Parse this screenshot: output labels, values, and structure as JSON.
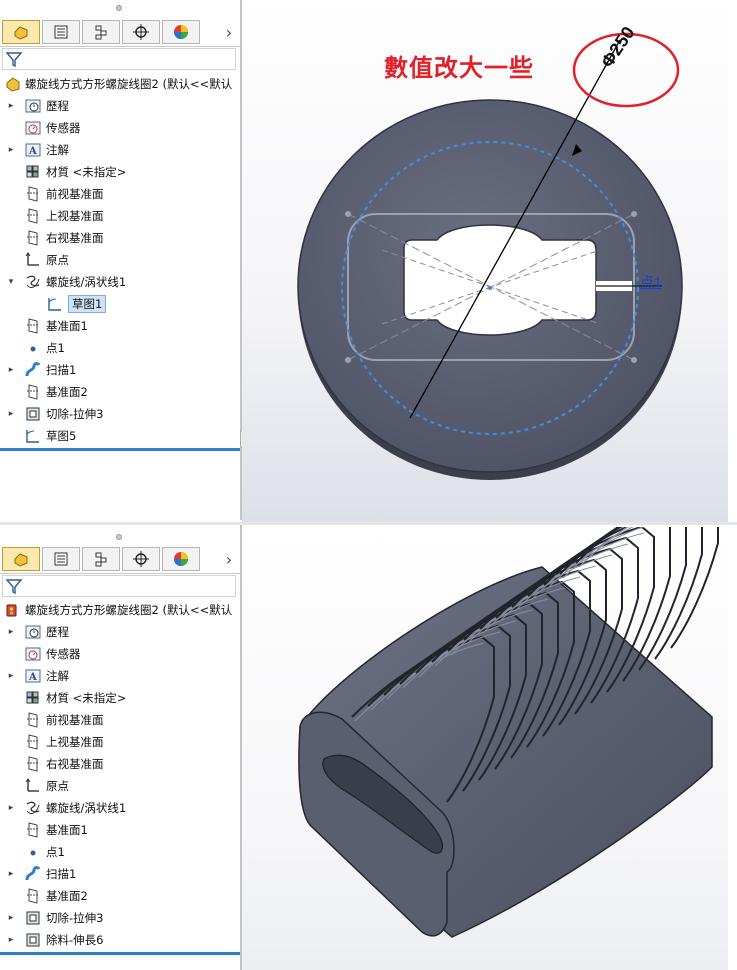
{
  "annotation": {
    "title": "數值改大一些",
    "dimension_text": "Φ250",
    "point_label": "点1"
  },
  "panels": [
    {
      "id": "top",
      "root_label": "螺旋线方式方形螺旋线圈2 (默认<<默认",
      "items": [
        {
          "label": "歷程",
          "icon": "history-icon",
          "arrow": "collapsed"
        },
        {
          "label": "传感器",
          "icon": "sensor-icon",
          "arrow": ""
        },
        {
          "label": "注解",
          "icon": "annotation-icon",
          "arrow": "collapsed"
        },
        {
          "label": "材質 <未指定>",
          "icon": "material-icon",
          "arrow": ""
        },
        {
          "label": "前视基准面",
          "icon": "plane-icon",
          "arrow": ""
        },
        {
          "label": "上视基准面",
          "icon": "plane-icon",
          "arrow": ""
        },
        {
          "label": "右视基准面",
          "icon": "plane-icon",
          "arrow": ""
        },
        {
          "label": "原点",
          "icon": "origin-icon",
          "arrow": ""
        },
        {
          "label": "螺旋线/涡状线1",
          "icon": "helix-icon",
          "arrow": "expanded"
        },
        {
          "label": "草图1",
          "icon": "sketch-icon",
          "arrow": "",
          "child": true,
          "selected": true
        },
        {
          "label": "基准面1",
          "icon": "plane-icon",
          "arrow": ""
        },
        {
          "label": "点1",
          "icon": "point-icon",
          "arrow": ""
        },
        {
          "label": "扫描1",
          "icon": "sweep-icon",
          "arrow": "collapsed"
        },
        {
          "label": "基准面2",
          "icon": "plane-icon",
          "arrow": ""
        },
        {
          "label": "切除-拉伸3",
          "icon": "cut-extrude-icon",
          "arrow": "collapsed"
        },
        {
          "label": "草图5",
          "icon": "sketch-icon",
          "arrow": ""
        }
      ]
    },
    {
      "id": "bottom",
      "root_label": "螺旋线方式方形螺旋线圈2 (默认<<默认",
      "items": [
        {
          "label": "歷程",
          "icon": "history-icon",
          "arrow": "collapsed"
        },
        {
          "label": "传感器",
          "icon": "sensor-icon",
          "arrow": ""
        },
        {
          "label": "注解",
          "icon": "annotation-icon",
          "arrow": "collapsed"
        },
        {
          "label": "材質 <未指定>",
          "icon": "material-icon",
          "arrow": ""
        },
        {
          "label": "前视基准面",
          "icon": "plane-icon",
          "arrow": ""
        },
        {
          "label": "上视基准面",
          "icon": "plane-icon",
          "arrow": ""
        },
        {
          "label": "右视基准面",
          "icon": "plane-icon",
          "arrow": ""
        },
        {
          "label": "原点",
          "icon": "origin-icon",
          "arrow": ""
        },
        {
          "label": "螺旋线/涡状线1",
          "icon": "helix-icon",
          "arrow": "collapsed"
        },
        {
          "label": "基准面1",
          "icon": "plane-icon",
          "arrow": ""
        },
        {
          "label": "点1",
          "icon": "point-icon",
          "arrow": ""
        },
        {
          "label": "扫描1",
          "icon": "sweep-icon",
          "arrow": "collapsed"
        },
        {
          "label": "基准面2",
          "icon": "plane-icon",
          "arrow": ""
        },
        {
          "label": "切除-拉伸3",
          "icon": "cut-extrude-icon",
          "arrow": "collapsed"
        },
        {
          "label": "除料-伸長6",
          "icon": "cut-extrude-icon",
          "arrow": "collapsed"
        }
      ]
    }
  ],
  "tabs": [
    {
      "icon": "feature-manager-icon"
    },
    {
      "icon": "property-manager-icon"
    },
    {
      "icon": "configuration-manager-icon"
    },
    {
      "icon": "dimxpert-icon"
    },
    {
      "icon": "display-manager-icon"
    }
  ],
  "colors": {
    "selection_blue": "#2f7fc6",
    "annotation_red": "#e0212a",
    "model_gray": "#5d6274"
  }
}
